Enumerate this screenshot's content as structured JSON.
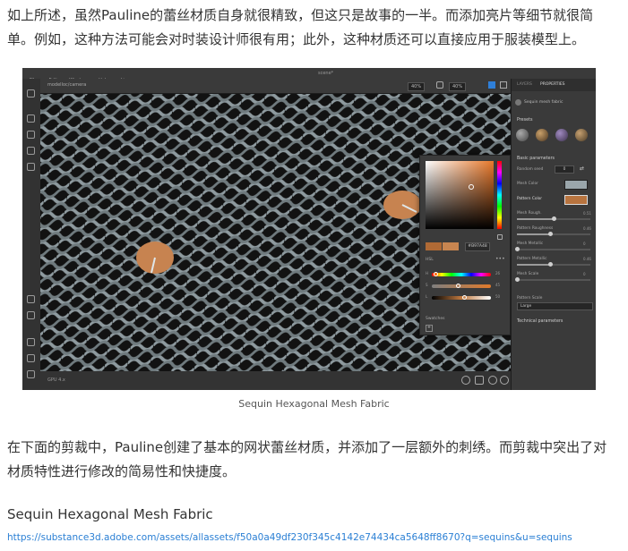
{
  "article": {
    "para1": "如上所述，虽然Pauline的蕾丝材质自身就很精致，但这只是故事的一半。而添加亮片等细节就很简单。例如，这种方法可能会对时装设计师很有用；此外，这种材质还可以直接应用于服装模型上。",
    "caption": "Sequin Hexagonal Mesh Fabric",
    "para2": "在下面的剪裁中，Pauline创建了基本的网状蕾丝材质，并添加了一层额外的刺绣。而剪裁中突出了对材质特性进行修改的简易性和快捷度。",
    "title2": "Sequin Hexagonal Mesh Fabric",
    "link": "https://substance3d.adobe.com/assets/allassets/f50a0a49df230f345c4142e74434ca5648ff8670?q=sequins&u=sequins"
  },
  "app": {
    "menu": [
      "File",
      "Edit",
      "Window",
      "Help",
      "License"
    ],
    "window_title": "scene*",
    "viewport": {
      "label": "modelloc/camera",
      "zoom1": "40%",
      "zoom2": "40%",
      "footer_label": "GPU 4.x"
    },
    "picker": {
      "hex": "#B97A48",
      "mode": "HSL",
      "rows": [
        {
          "label": "H",
          "value": "26",
          "knob": 0.07
        },
        {
          "label": "S",
          "value": "45",
          "knob": 0.45
        },
        {
          "label": "L",
          "value": "50",
          "knob": 0.55
        }
      ],
      "swatches_label": "Swatches",
      "add": "+"
    },
    "panel": {
      "tabs": [
        "LAYERS",
        "PROPERTIES"
      ],
      "material_name": "Sequin mesh fabric",
      "presets_title": "Presets",
      "basic_title": "Basic parameters",
      "random_seed_label": "Random seed",
      "random_seed_value": "0",
      "mesh_color_label": "Mesh Color",
      "mesh_color": "#9aa6ab",
      "pattern_color_label": "Pattern Color",
      "pattern_color": "#b8743f",
      "params": [
        {
          "label": "Mesh Rough.",
          "value": "0.51",
          "level": 0.51
        },
        {
          "label": "Pattern Roughness",
          "value": "0.46",
          "level": 0.46
        },
        {
          "label": "Mesh Metallic",
          "value": "0",
          "level": 0.0
        },
        {
          "label": "Pattern Metallic",
          "value": "0.46",
          "level": 0.46
        },
        {
          "label": "Mesh Scale",
          "value": "0",
          "level": 0.0
        }
      ],
      "pattern_scale_label": "Pattern Scale",
      "pattern_scale_value": "Large",
      "technical_title": "Technical parameters"
    }
  }
}
